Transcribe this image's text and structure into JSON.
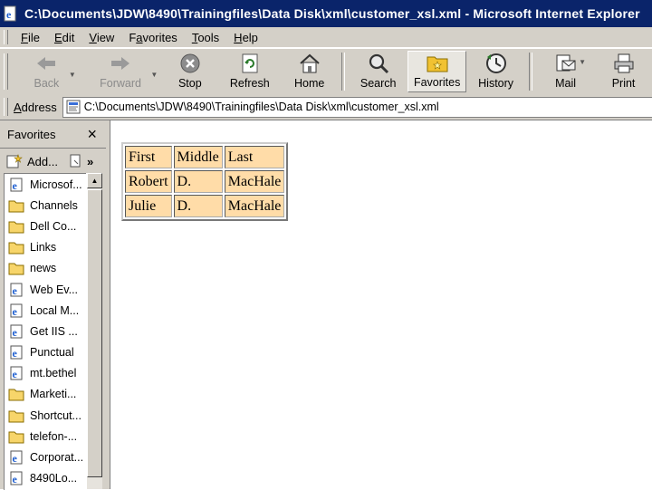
{
  "window": {
    "title": "C:\\Documents\\JDW\\8490\\Trainingfiles\\Data Disk\\xml\\customer_xsl.xml - Microsoft Internet Explorer"
  },
  "menubar": {
    "items": [
      {
        "key": "F",
        "rest": "ile"
      },
      {
        "key": "E",
        "rest": "dit"
      },
      {
        "key": "V",
        "rest": "iew"
      },
      {
        "key": "a",
        "prefix": "F",
        "rest": "vorites"
      },
      {
        "key": "T",
        "rest": "ools"
      },
      {
        "key": "H",
        "rest": "elp"
      }
    ]
  },
  "toolbar": {
    "back": "Back",
    "forward": "Forward",
    "stop": "Stop",
    "refresh": "Refresh",
    "home": "Home",
    "search": "Search",
    "favorites": "Favorites",
    "history": "History",
    "mail": "Mail",
    "print": "Print"
  },
  "address": {
    "label_key": "A",
    "label_rest": "ddress",
    "url": "C:\\Documents\\JDW\\8490\\Trainingfiles\\Data Disk\\xml\\customer_xsl.xml"
  },
  "favorites_pane": {
    "title": "Favorites",
    "close": "×",
    "add": "Add...",
    "more": "»",
    "items": [
      {
        "label": "Microsof...",
        "icon": "ie-page-icon"
      },
      {
        "label": "Channels",
        "icon": "folder-icon"
      },
      {
        "label": "Dell Co...",
        "icon": "folder-icon"
      },
      {
        "label": "Links",
        "icon": "folder-icon"
      },
      {
        "label": "news",
        "icon": "folder-icon"
      },
      {
        "label": "Web Ev...",
        "icon": "ie-page-icon"
      },
      {
        "label": "Local M...",
        "icon": "ie-page-icon"
      },
      {
        "label": "Get IIS ...",
        "icon": "ie-page-icon"
      },
      {
        "label": "Punctual",
        "icon": "ie-page-icon"
      },
      {
        "label": "mt.bethel",
        "icon": "ie-page-icon"
      },
      {
        "label": "Marketi...",
        "icon": "folder-icon"
      },
      {
        "label": "Shortcut...",
        "icon": "folder-icon"
      },
      {
        "label": "telefon-...",
        "icon": "folder-icon"
      },
      {
        "label": "Corporat...",
        "icon": "ie-page-icon"
      },
      {
        "label": "8490Lo...",
        "icon": "ie-page-icon"
      }
    ]
  },
  "content": {
    "table": {
      "rows": [
        [
          "First",
          "Middle",
          "Last"
        ],
        [
          "Robert",
          "D.",
          "MacHale"
        ],
        [
          "Julie",
          "D.",
          "MacHale"
        ]
      ]
    }
  },
  "colors": {
    "titlebar": "#0a246a",
    "chrome": "#d4d0c8",
    "cell_bg": "#ffdca8"
  }
}
